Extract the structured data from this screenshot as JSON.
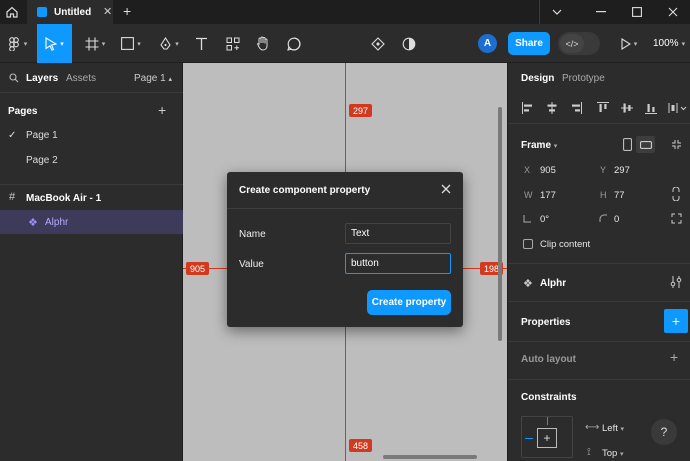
{
  "titlebar": {
    "tab_title": "Untitled",
    "icons": [
      "home-icon",
      "file-icon",
      "close-icon",
      "plus-icon",
      "chevron-down-icon",
      "minimize-icon",
      "maximize-icon",
      "close-window-icon"
    ]
  },
  "toolbar": {
    "avatar_initial": "A",
    "share_label": "Share",
    "zoom": "100%",
    "tools": [
      "figma-menu-icon",
      "move-tool-icon",
      "frame-tool-icon",
      "rectangle-tool-icon",
      "pen-tool-icon",
      "text-tool-icon",
      "component-tool-icon",
      "hand-tool-icon",
      "comment-tool-icon",
      "components-icon",
      "contrast-icon",
      "dev-mode-icon",
      "present-icon"
    ]
  },
  "left_panel": {
    "tabs": {
      "layers": "Layers",
      "assets": "Assets",
      "page_selector": "Page 1"
    },
    "pages_heading": "Pages",
    "pages": [
      "Page 1",
      "Page 2"
    ],
    "frame_name": "MacBook Air - 1",
    "component_name": "Alphr"
  },
  "canvas": {
    "measure_top": "297",
    "measure_left": "905",
    "measure_right": "198",
    "measure_bottom": "458",
    "guide_color": "#d23a1f"
  },
  "dialog": {
    "title": "Create component property",
    "name_label": "Name",
    "name_value": "Text",
    "value_label": "Value",
    "value_value": "button",
    "submit_label": "Create property"
  },
  "right_panel": {
    "tabs": {
      "design": "Design",
      "prototype": "Prototype"
    },
    "frame_heading": "Frame",
    "x_label": "X",
    "x_value": "905",
    "y_label": "Y",
    "y_value": "297",
    "w_label": "W",
    "w_value": "177",
    "h_label": "H",
    "h_value": "77",
    "rotation_value": "0°",
    "radius_value": "0",
    "clip_content_label": "Clip content",
    "component_name": "Alphr",
    "properties_heading": "Properties",
    "auto_layout_heading": "Auto layout",
    "constraints_heading": "Constraints",
    "constraint_h": "Left",
    "constraint_v": "Top"
  },
  "help_label": "?",
  "accent_color": "#0d99ff"
}
